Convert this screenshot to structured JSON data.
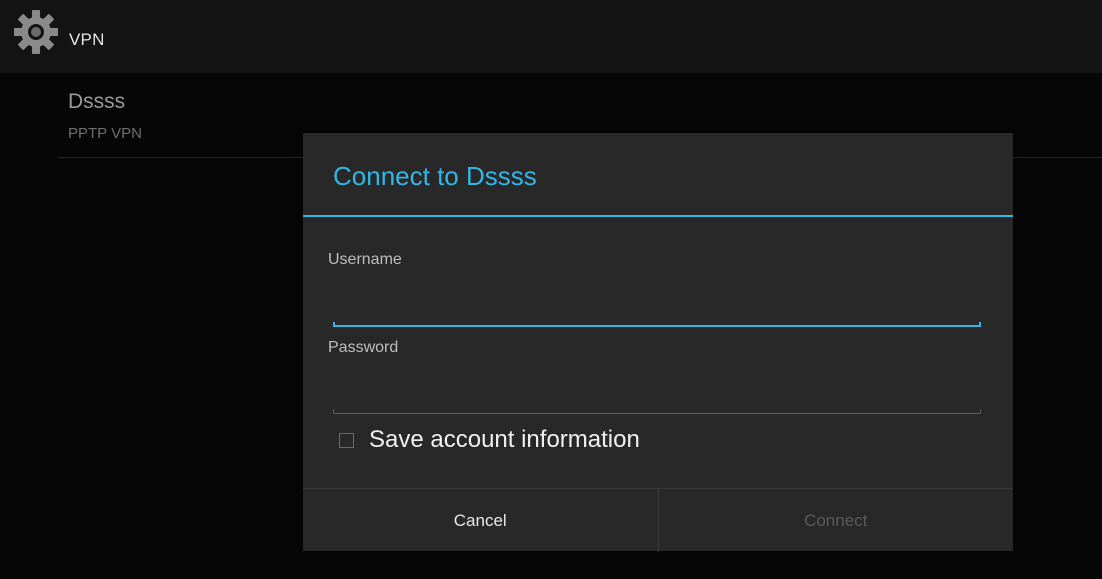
{
  "action_bar": {
    "icon": "gear-icon",
    "title": "VPN"
  },
  "vpn_list": {
    "items": [
      {
        "name": "Dssss",
        "type": "PPTP VPN"
      }
    ]
  },
  "dialog": {
    "title": "Connect to Dssss",
    "username": {
      "label": "Username",
      "value": "",
      "placeholder": ""
    },
    "password": {
      "label": "Password",
      "value": "",
      "placeholder": ""
    },
    "save_account": {
      "label": "Save account information",
      "checked": false
    },
    "buttons": {
      "cancel": "Cancel",
      "connect": "Connect"
    }
  },
  "colors": {
    "accent": "#33b5e5",
    "dialog_bg": "#282828",
    "disabled_text": "#5a5a5a"
  }
}
